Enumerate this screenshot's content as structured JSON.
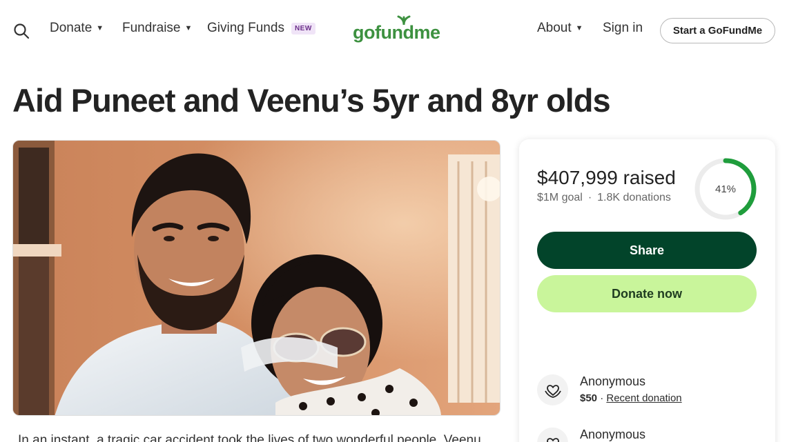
{
  "header": {
    "nav": {
      "donate": "Donate",
      "fundraise": "Fundraise",
      "giving_funds": "Giving Funds",
      "giving_funds_badge": "NEW",
      "about": "About",
      "sign_in": "Sign in"
    },
    "logo_text": "gofundme",
    "start_button": "Start a GoFundMe",
    "icons": {
      "search": "search-icon",
      "caret": "caret-down-icon"
    }
  },
  "campaign": {
    "title": "Aid Puneet and Veenu’s 5yr and 8yr olds",
    "story_preview": "In an instant, a tragic car accident took the lives of two wonderful people, Veenu"
  },
  "donation_card": {
    "raised": "$407,999 raised",
    "goal": "$1M goal",
    "separator": "·",
    "donations": "1.8K donations",
    "progress_percent": 41,
    "progress_label": "41%",
    "share_button": "Share",
    "donate_button": "Donate now",
    "recent_donors": [
      {
        "name": "Anonymous",
        "amount": "$50",
        "separator": "·",
        "note": "Recent donation",
        "icon": "heart-hands-icon"
      },
      {
        "name": "Anonymous",
        "icon": "heart-hands-icon"
      }
    ]
  },
  "colors": {
    "brand_green": "#3d9140",
    "share_bg": "#02442a",
    "donate_bg": "#c9f59b",
    "progress_green": "#1f9d3c",
    "progress_track": "#ececec"
  }
}
